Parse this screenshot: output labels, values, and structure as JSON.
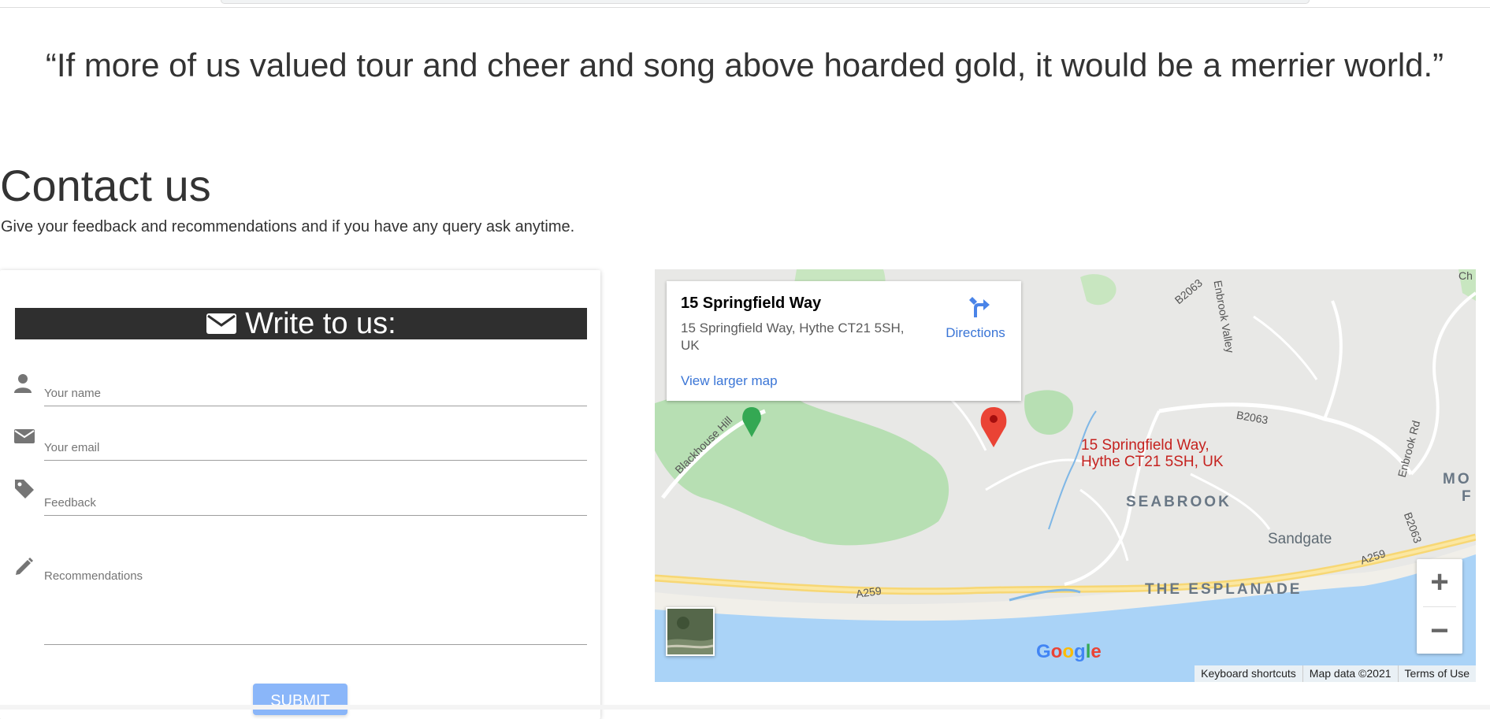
{
  "quote": "“If more of us valued tour and cheer and song above hoarded gold, it would be a merrier world.”",
  "contact": {
    "title": "Contact us",
    "subtitle": "Give your feedback and recommendations and if you have any query ask anytime."
  },
  "form": {
    "header": "Write to us:",
    "header_icon": "envelope-icon",
    "fields": [
      {
        "placeholder": "Your name",
        "icon": "user-icon"
      },
      {
        "placeholder": "Your email",
        "icon": "envelope-icon"
      },
      {
        "placeholder": "Feedback",
        "icon": "tag-icon"
      },
      {
        "placeholder": "Recommendations",
        "icon": "pencil-icon"
      }
    ],
    "submit_label": "SUBMIT",
    "submit_color": "#8ab6f9"
  },
  "map": {
    "place_title": "15 Springfield Way",
    "place_address": "15 Springfield Way, Hythe CT21 5SH, UK",
    "view_larger": "View larger map",
    "directions": "Directions",
    "pin_label_line1": "15 Springfield Way,",
    "pin_label_line2": "Hythe CT21 5SH, UK",
    "areas": {
      "seabrook": "SEABROOK",
      "sandgate": "Sandgate",
      "esplanade": "THE ESPLANADE",
      "mo": "MO",
      "f": "F"
    },
    "roads": {
      "a259_left": "A259",
      "a259_right": "A259",
      "b2063_top": "B2063",
      "b2063_mid": "B2063",
      "b2063_right": "B2063",
      "enbrook_valley": "Enbrook Valley",
      "enbrook_rd": "Enbrook Rd",
      "blackhouse_hill": "Blackhouse Hill",
      "ch": "Ch"
    },
    "zoom_in": "+",
    "zoom_out": "−",
    "logo": "Google",
    "footer": {
      "shortcuts": "Keyboard shortcuts",
      "data": "Map data ©2021",
      "terms": "Terms of Use"
    },
    "pin_color": "#ea4335",
    "link_color": "#3a75d6"
  }
}
